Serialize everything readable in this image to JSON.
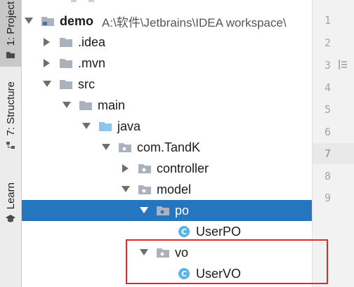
{
  "side_toolbar": {
    "project_tab": "1: Project",
    "structure_tab": "7: Structure",
    "learn_tab": "Learn"
  },
  "tree": {
    "root": {
      "label": "demo",
      "path": "A:\\软件\\Jetbrains\\IDEA workspace\\"
    },
    "idea": ".idea",
    "mvn": ".mvn",
    "src": "src",
    "main": "main",
    "java": "java",
    "package": "com.TandK",
    "controller": "controller",
    "model": "model",
    "po": "po",
    "user_po": "UserPO",
    "vo": "vo",
    "user_vo": "UserVO"
  },
  "gutter": {
    "lines": [
      "1",
      "2",
      "3",
      "4",
      "5",
      "6",
      "7",
      "8",
      "9"
    ],
    "current_line": "7"
  },
  "colors": {
    "selection": "#2675bf",
    "highlight_box": "#e0282e",
    "folder": "#aab2bd",
    "source_folder": "#8cc6e8",
    "class_icon": "#59b4e6"
  }
}
